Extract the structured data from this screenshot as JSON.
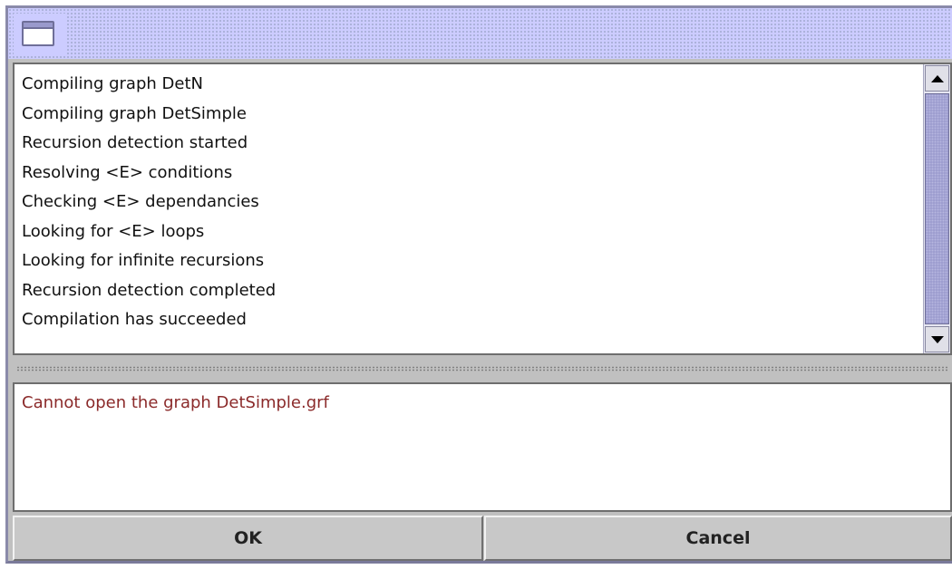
{
  "title_bar": {
    "icon": "window-icon"
  },
  "log_output": {
    "lines": [
      "Compiling graph DetN",
      "Compiling graph DetSimple",
      "Recursion detection started",
      "Resolving <E> conditions",
      "Checking <E> dependancies",
      "Looking for <E> loops",
      "Looking for infinite recursions",
      "Recursion detection completed",
      "Compilation has succeeded"
    ],
    "scrollbar": {
      "up_icon": "arrow-up-icon",
      "down_icon": "arrow-down-icon"
    }
  },
  "error_output": {
    "message": "Cannot open the graph DetSimple.grf",
    "color": "#8b2a2a"
  },
  "buttons": {
    "ok_label": "OK",
    "cancel_label": "Cancel"
  },
  "colors": {
    "titlebar": "#ccccff",
    "scrollbar_thumb": "#9999cc",
    "window_background": "#c0c0c0"
  }
}
